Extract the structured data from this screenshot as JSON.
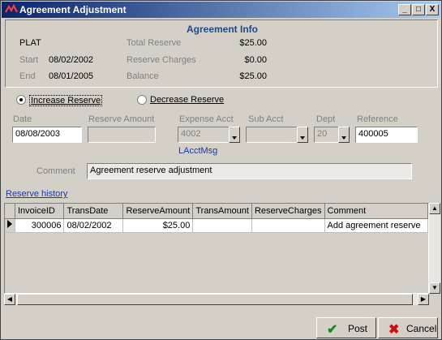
{
  "window": {
    "title": "Agreement Adjustment",
    "minimize": "_",
    "maximize": "□",
    "close": "X"
  },
  "info": {
    "title": "Agreement Info",
    "code": "PLAT",
    "start_label": "Start",
    "start_value": "08/02/2002",
    "end_label": "End",
    "end_value": "08/01/2005",
    "total_reserve_label": "Total Reserve",
    "total_reserve_value": "$25.00",
    "reserve_charges_label": "Reserve Charges",
    "reserve_charges_value": "$0.00",
    "balance_label": "Balance",
    "balance_value": "$25.00"
  },
  "options": {
    "increase_label": "Increase Reserve",
    "decrease_label": "Decrease Reserve",
    "selected": "increase"
  },
  "form": {
    "date_label": "Date",
    "date_value": "08/08/2003",
    "reserve_amount_label": "Reserve Amount",
    "reserve_amount_value": "",
    "expense_acct_label": "Expense Acct",
    "expense_acct_value": "4002",
    "sub_acct_label": "Sub Acct",
    "sub_acct_value": "",
    "dept_label": "Dept",
    "dept_value": "20",
    "reference_label": "Reference",
    "reference_value": "400005",
    "acct_msg": "LAcctMsg",
    "comment_label": "Comment",
    "comment_value": "Agreement reserve adjustment"
  },
  "history": {
    "label": "Reserve history",
    "columns": [
      "InvoiceID",
      "TransDate",
      "ReserveAmount",
      "TransAmount",
      "ReserveCharges",
      "Comment"
    ],
    "rows": [
      [
        "300006",
        "08/02/2002",
        "$25.00",
        "",
        "",
        "Add agreement reserve"
      ]
    ]
  },
  "buttons": {
    "post": "Post",
    "cancel": "Cancel"
  },
  "colors": {
    "title_start": "#0a246a",
    "title_end": "#a6caf0",
    "info_title": "#1c4a8a",
    "link": "#1c3aa0",
    "post_icon": "#1a8a1a",
    "cancel_icon": "#c81010"
  }
}
